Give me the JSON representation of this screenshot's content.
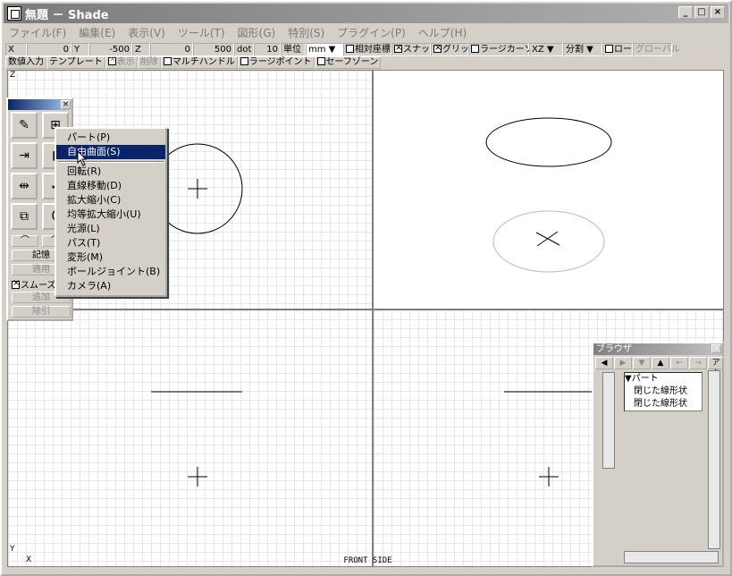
{
  "window": {
    "title": "無題 － Shade",
    "min": "_",
    "max": "□",
    "close": "×"
  },
  "menu": [
    "ファイル(F)",
    "編集(E)",
    "表示(V)",
    "ツール(T)",
    "図形(G)",
    "特別(S)",
    "プラグイン(P)",
    "ヘルプ(H)"
  ],
  "coords": {
    "x_label": "X",
    "x_val": "0",
    "y_label": "Y",
    "y_val": "-500",
    "z_label": "Z",
    "z_val": "0",
    "w_val": "500",
    "dot_label": "dot",
    "grid_val": "10",
    "unit_label": "単位",
    "unit_val": "mm",
    "relative": "相対座標",
    "snap": "スナップ",
    "grid": "グリッド",
    "large_cursor": "ラージカーソル",
    "plane": "XZ",
    "divide": "分割",
    "local": "ローカル",
    "global": "グローバル"
  },
  "template": {
    "numeric_input": "数値入力",
    "template": "テンプレート",
    "show": "表示",
    "delete": "削除",
    "multi_handle": "マルチハンドル",
    "large_point": "ラージポイント",
    "safe_zone": "セーフゾーン"
  },
  "palette": {
    "memory": "記憶",
    "apply": "適用",
    "smooth": "スムーズ",
    "add": "追加",
    "subtract": "除引"
  },
  "context_menu": [
    "パート(P)",
    "自由曲面(S)",
    "回転(R)",
    "直線移動(D)",
    "拡大縮小(C)",
    "均等拡大縮小(U)",
    "光源(L)",
    "パス(T)",
    "変形(M)",
    "ボールジョイント(B)",
    "カメラ(A)"
  ],
  "browser": {
    "title": "ブラウザ",
    "tab": "アク",
    "tree": [
      "▼パート",
      "閉じた線形状",
      "閉じた線形状"
    ]
  },
  "status": {
    "view_label": "FRONT SIDE",
    "x_axis": "X",
    "y_axis": "Y",
    "z_axis": "Z"
  }
}
